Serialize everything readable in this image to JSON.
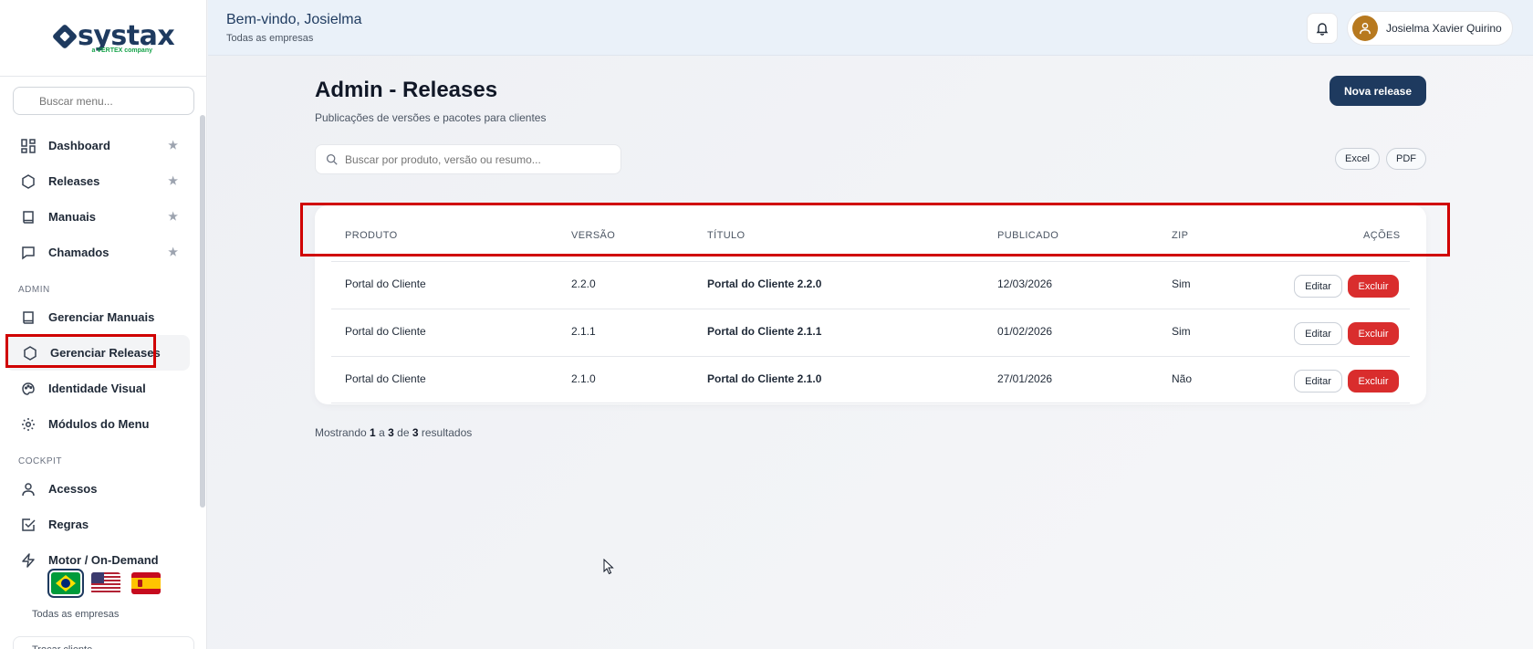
{
  "sidebar": {
    "logo_text": "systax",
    "logo_sub": "a VERTEX company",
    "search_placeholder": "Buscar menu...",
    "items": [
      {
        "label": "Dashboard"
      },
      {
        "label": "Releases"
      },
      {
        "label": "Manuais"
      },
      {
        "label": "Chamados"
      }
    ],
    "admin_label": "ADMIN",
    "admin_items": [
      {
        "label": "Gerenciar Manuais"
      },
      {
        "label": "Gerenciar Releases"
      },
      {
        "label": "Identidade Visual"
      },
      {
        "label": "Módulos do Menu"
      }
    ],
    "cockpit_label": "COCKPIT",
    "cockpit_items": [
      {
        "label": "Acessos"
      },
      {
        "label": "Regras"
      },
      {
        "label": "Motor / On-Demand"
      }
    ],
    "star": "★",
    "company": "Todas as empresas",
    "switch_client": "Trocar cliente"
  },
  "header": {
    "welcome": "Bem-vindo, Josielma",
    "subtitle": "Todas as empresas",
    "user_name": "Josielma Xavier Quirino"
  },
  "main": {
    "title": "Admin - Releases",
    "subtitle": "Publicações de versões e pacotes para clientes",
    "new_button": "Nova release",
    "search_placeholder": "Buscar por produto, versão ou resumo...",
    "excel": "Excel",
    "pdf": "PDF",
    "columns": {
      "produto": "PRODUTO",
      "versao": "VERSÃO",
      "titulo": "TÍTULO",
      "publicado": "PUBLICADO",
      "zip": "ZIP",
      "acoes": "AÇÕES"
    },
    "rows": [
      {
        "produto": "Portal do Cliente",
        "versao": "2.2.0",
        "titulo": "Portal do Cliente 2.2.0",
        "publicado": "12/03/2026",
        "zip": "Sim"
      },
      {
        "produto": "Portal do Cliente",
        "versao": "2.1.1",
        "titulo": "Portal do Cliente 2.1.1",
        "publicado": "01/02/2026",
        "zip": "Sim"
      },
      {
        "produto": "Portal do Cliente",
        "versao": "2.1.0",
        "titulo": "Portal do Cliente 2.1.0",
        "publicado": "27/01/2026",
        "zip": "Não"
      }
    ],
    "edit_label": "Editar",
    "delete_label": "Excluir",
    "results": {
      "prefix": "Mostrando",
      "from": "1",
      "a": "a",
      "to": "3",
      "de": "de",
      "total": "3",
      "suffix": "resultados"
    }
  },
  "colors": {
    "primary": "#1e3a5f",
    "danger": "#d92d2d",
    "highlight": "#d00000"
  }
}
